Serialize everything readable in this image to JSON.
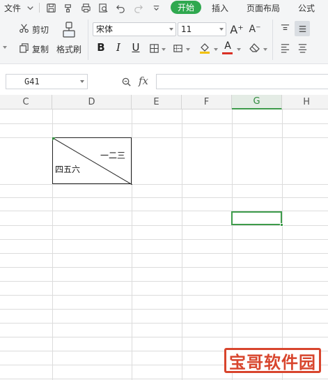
{
  "menubar": {
    "file_label": "文件",
    "tabs": [
      {
        "label": "开始",
        "active": true
      },
      {
        "label": "插入",
        "active": false
      },
      {
        "label": "页面布局",
        "active": false
      },
      {
        "label": "公式",
        "active": false
      }
    ],
    "quick_icons": [
      "save-icon",
      "format-painter-icon",
      "print-icon",
      "print-preview-icon",
      "undo-icon",
      "redo-icon",
      "customize-icon"
    ]
  },
  "ribbon": {
    "cut_label": "剪切",
    "copy_label": "复制",
    "format_painter_label": "格式刷",
    "font_name": "宋体",
    "font_size": "11",
    "bold": "B",
    "italic": "I",
    "underline": "U",
    "increase_font": "A⁺",
    "decrease_font": "A⁻",
    "font_color_letter": "A",
    "accent_color": "#2fa84f",
    "font_color": "#d93025"
  },
  "formula_bar": {
    "cell_ref": "G41",
    "fx_label": "fx",
    "formula_value": ""
  },
  "sheet": {
    "columns": [
      {
        "label": "C",
        "selected": false
      },
      {
        "label": "D",
        "selected": false
      },
      {
        "label": "E",
        "selected": false
      },
      {
        "label": "F",
        "selected": false
      },
      {
        "label": "G",
        "selected": true
      },
      {
        "label": "H",
        "selected": false
      }
    ],
    "diagonal_cell": {
      "top_right_text": "一二三",
      "bottom_left_text": "四五六"
    },
    "active_cell": "G41"
  },
  "watermark": {
    "text": "宝哥软件园",
    "color": "#d8452d"
  }
}
